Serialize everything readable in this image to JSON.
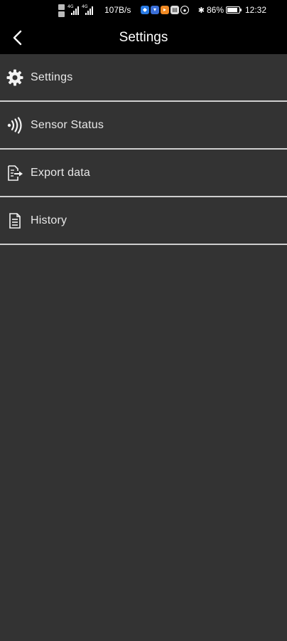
{
  "status_bar": {
    "network_speed": "107B/s",
    "battery_percent": "86%",
    "time": "12:32",
    "battery_level": 0.86
  },
  "header": {
    "title": "Settings",
    "back_icon": "chevron-left-icon"
  },
  "menu": {
    "items": [
      {
        "label": "Settings",
        "icon": "gear-icon"
      },
      {
        "label": "Sensor Status",
        "icon": "sensor-wave-icon"
      },
      {
        "label": "Export data",
        "icon": "export-icon"
      },
      {
        "label": "History",
        "icon": "document-icon"
      }
    ]
  },
  "colors": {
    "background": "#333333",
    "header": "#000000",
    "divider": "#cfcfcf",
    "text": "#e8e8e8"
  }
}
